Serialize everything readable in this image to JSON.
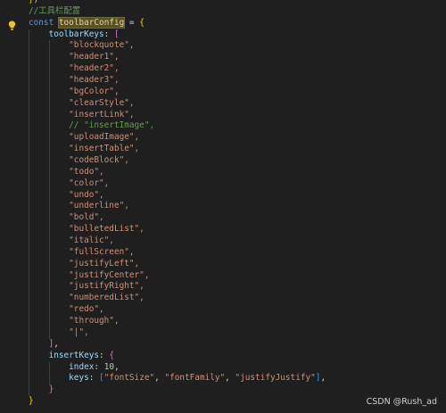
{
  "editor": {
    "comment": "//工具栏配置",
    "decl_keyword": "const",
    "config_name": "toolbarConfig",
    "toolbar_keys_name": "toolbarKeys",
    "commented_item": "// \"insertImage\",",
    "toolbar_keys": [
      "\"blockquote\",",
      "\"header1\",",
      "\"header2\",",
      "\"header3\",",
      "\"bgColor\",",
      "\"clearStyle\",",
      "\"insertLink\",",
      "COMMENT",
      "\"uploadImage\",",
      "\"insertTable\",",
      "\"codeBlock\",",
      "\"todo\",",
      "\"color\",",
      "\"undo\",",
      "\"underline\",",
      "\"bold\",",
      "\"bulletedList\",",
      "\"italic\",",
      "\"fullScreen\",",
      "\"justifyLeft\",",
      "\"justifyCenter\",",
      "\"justifyRight\",",
      "\"numberedList\",",
      "\"redo\",",
      "\"through\",",
      "\"|\","
    ],
    "insert_keys_name": "insertKeys",
    "index_key": "index",
    "index_value": "10",
    "keys_key": "keys",
    "keys_values": [
      "\"fontSize\"",
      "\"fontFamily\"",
      "\"justifyJustify\""
    ]
  },
  "watermark": "CSDN @Rush_ad",
  "colors": {
    "background": "#1f1f1f",
    "keyword": "#569cd6",
    "string": "#ce9178",
    "property": "#9cdcfe",
    "comment": "#6a9955",
    "number": "#b5cea8",
    "bulb": "#e8c240"
  }
}
